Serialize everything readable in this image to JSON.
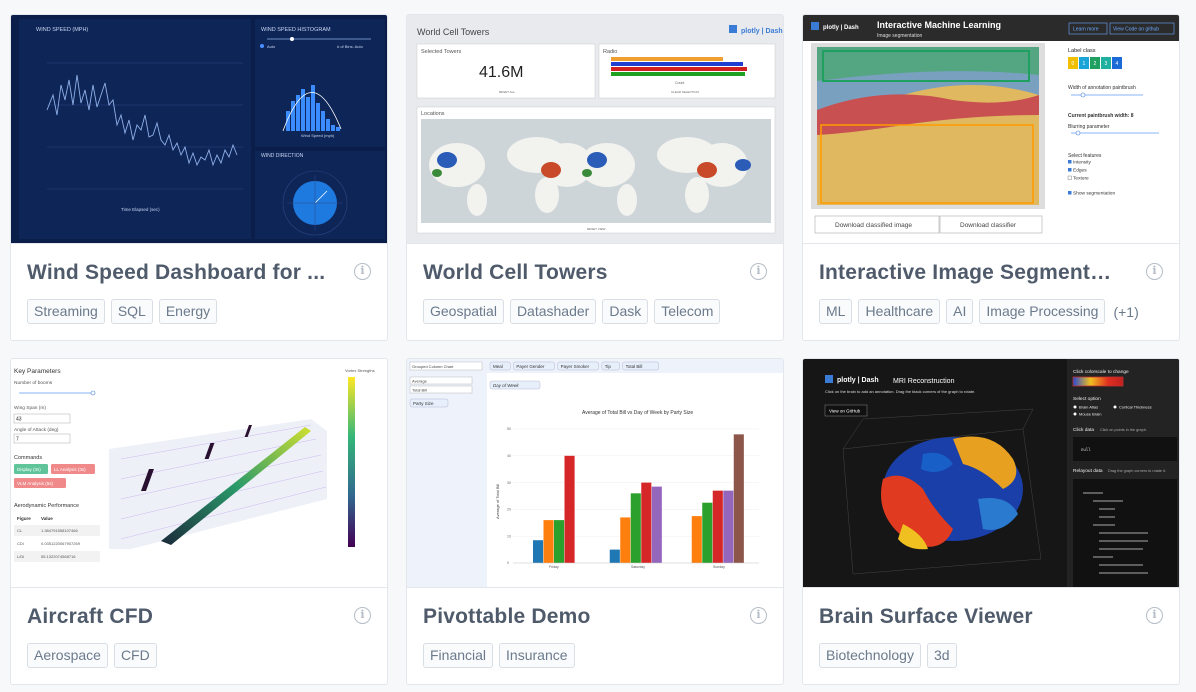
{
  "cards": [
    {
      "title": "Wind Speed Dashboard for ...",
      "tags": [
        "Streaming",
        "SQL",
        "Energy"
      ],
      "thumb": {
        "panel1": "WIND SPEED (MPH)",
        "panel2": "WIND SPEED HISTOGRAM",
        "panel3": "WIND DIRECTION",
        "xaxis": "Time Elapsed (sec)",
        "hist_xaxis": "Wind Speed (mph)",
        "auto": "Auto",
        "bins": "# of Bins: Auto",
        "legend": [
          "Average",
          "Median",
          "Rayleigh Fit"
        ]
      }
    },
    {
      "title": "World Cell Towers",
      "tags": [
        "Geospatial",
        "Datashader",
        "Dask",
        "Telecom"
      ],
      "thumb": {
        "heading": "World Cell Towers",
        "brand": "plotly | Dash",
        "selected_label": "Selected Towers",
        "selected_value": "41.6M",
        "radio_label": "Radio",
        "locations_label": "Locations",
        "reset_all": "RESET ALL",
        "clear_selection": "CLEAR SELECTION",
        "reset_view": "RESET VIEW",
        "count": "Count"
      }
    },
    {
      "title": "Interactive Image Segmenta...",
      "tags": [
        "ML",
        "Healthcare",
        "AI",
        "Image Processing"
      ],
      "more": "(+1)",
      "thumb": {
        "heading": "Interactive Machine Learning",
        "subheading": "Image segmentation",
        "learn_more": "Learn more",
        "view_code": "View Code on github",
        "label_class": "Label class",
        "classes": [
          "0",
          "1",
          "2",
          "3",
          "4"
        ],
        "width_label": "Width of annotation paintbrush",
        "current_width": "Current paintbrush width: 8",
        "blurring": "Blurring parameter",
        "select_features": "Select features",
        "features": [
          "Intensity",
          "Edges",
          "Texture"
        ],
        "show_seg": "Show segmentation",
        "download_image": "Download classified image",
        "download_classifier": "Download classifier"
      }
    },
    {
      "title": "Aircraft CFD",
      "tags": [
        "Aerospace",
        "CFD"
      ],
      "thumb": {
        "key_params": "Key Parameters",
        "num_booms": "Number of booms",
        "wing_span": "Wing Span (m)",
        "wing_span_val": "43",
        "angle": "Angle of Attack (deg)",
        "angle_val": "7",
        "commands": "Commands",
        "btn_display": "Display (3s)",
        "btn_ll": "LL Analysis (3s)",
        "btn_vlm": "VLM Analysis (5s)",
        "aero_perf": "Aerodynamic Performance",
        "col_figure": "Figure",
        "col_value": "Value",
        "rows": [
          [
            "CL",
            "1.384791558107466"
          ],
          [
            "CDi",
            "0.0351220067907269"
          ],
          [
            "L/Di",
            "55.1322074568716"
          ]
        ],
        "colorbar": "Vortex Strengths"
      }
    },
    {
      "title": "Pivottable Demo",
      "tags": [
        "Financial",
        "Insurance"
      ],
      "thumb": {
        "renderer": "Grouped Column Chart",
        "aggregator": "Average",
        "attr": "Total Bill",
        "pills": [
          "Meal",
          "Payer Gender",
          "Payer Smoker",
          "Tip",
          "Total Bill"
        ],
        "col_field": "Day of Week",
        "row_field": "Party Size",
        "chart_title": "Average of Total Bill vs Day of Week by Party Size",
        "ylabel": "Average of Total Bill",
        "days": [
          "Friday",
          "Saturday",
          "Sunday"
        ],
        "yticks": [
          "0",
          "10",
          "20",
          "30",
          "40",
          "50"
        ]
      }
    },
    {
      "title": "Brain Surface Viewer",
      "tags": [
        "Biotechnology",
        "3d"
      ],
      "thumb": {
        "brand": "plotly | Dash",
        "heading": "MRI Reconstruction",
        "instructions": "Click on the brain to add an annotation. Drag the black corners of the graph to rotate.",
        "github": "View on GitHub",
        "colorscale": "Click colorscale to change",
        "select_option": "Select option",
        "options": [
          "Brain Atlas",
          "Cortical Thickness",
          "Mouse Brain"
        ],
        "click_data": "Click data",
        "click_hint": "Click on points in the graph.",
        "null": "null",
        "relayout": "Relayout data",
        "relayout_hint": "Drag the graph corners to rotate it."
      }
    }
  ],
  "chart_data": {
    "type": "bar",
    "title": "Average of Total Bill vs Day of Week by Party Size",
    "ylabel": "Average of Total Bill",
    "categories": [
      "Friday",
      "Saturday",
      "Sunday"
    ],
    "ylim": [
      0,
      50
    ],
    "series": [
      {
        "color": "#1f77b4",
        "values": [
          8.5,
          5,
          null
        ]
      },
      {
        "color": "#ff7f0e",
        "values": [
          16,
          17,
          17.5
        ]
      },
      {
        "color": "#2ca02c",
        "values": [
          16,
          26,
          22.5
        ]
      },
      {
        "color": "#d62728",
        "values": [
          40,
          30,
          27
        ]
      },
      {
        "color": "#9467bd",
        "values": [
          null,
          28.5,
          27
        ]
      },
      {
        "color": "#8c564b",
        "values": [
          null,
          null,
          48
        ]
      }
    ]
  }
}
